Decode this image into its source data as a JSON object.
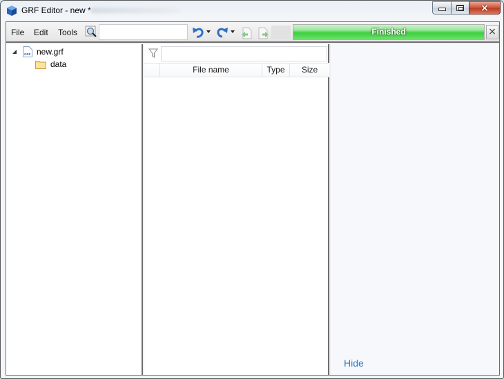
{
  "window": {
    "title": "GRF Editor - new *",
    "caption_buttons": {
      "minimize": "minimize",
      "maximize": "maximize",
      "close": "×"
    }
  },
  "toolbar": {
    "menus": [
      "File",
      "Edit",
      "Tools"
    ],
    "search": {
      "value": "",
      "placeholder": ""
    },
    "icons": {
      "search": "magnifier-icon",
      "undo": "undo-icon",
      "redo": "redo-icon",
      "extract": "extract-file-icon",
      "add": "add-file-icon"
    },
    "progress": {
      "label": "Finished",
      "percent": 100,
      "fill_color": "#3ccf3c"
    },
    "progress_close": "×"
  },
  "tree": {
    "items": [
      {
        "label": "new.grf",
        "icon": "grf-file-icon",
        "expanded": true
      },
      {
        "label": "data",
        "icon": "folder-icon"
      }
    ]
  },
  "file_list": {
    "filter": {
      "value": "",
      "placeholder": ""
    },
    "columns": [
      "",
      "File name",
      "Type",
      "Size"
    ],
    "rows": []
  },
  "preview": {
    "hide_label": "Hide",
    "link_color": "#2f7bbf"
  }
}
